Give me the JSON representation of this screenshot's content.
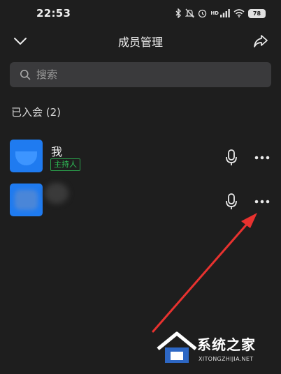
{
  "status_bar": {
    "time": "22:53",
    "battery": "78",
    "network_label": "HD"
  },
  "header": {
    "title": "成员管理"
  },
  "search": {
    "placeholder": "搜索"
  },
  "section": {
    "title": "已入会 (2)"
  },
  "members": [
    {
      "name": "我",
      "badge": "主持人"
    },
    {
      "name": ""
    }
  ],
  "watermark": {
    "text": "系统之家",
    "sub": "XITONGZHIJIA.NET"
  },
  "colors": {
    "background": "#1e1e1e",
    "avatar": "#1f7bf0",
    "host_badge": "#2fbf57",
    "annotation_arrow": "#e8322f"
  }
}
